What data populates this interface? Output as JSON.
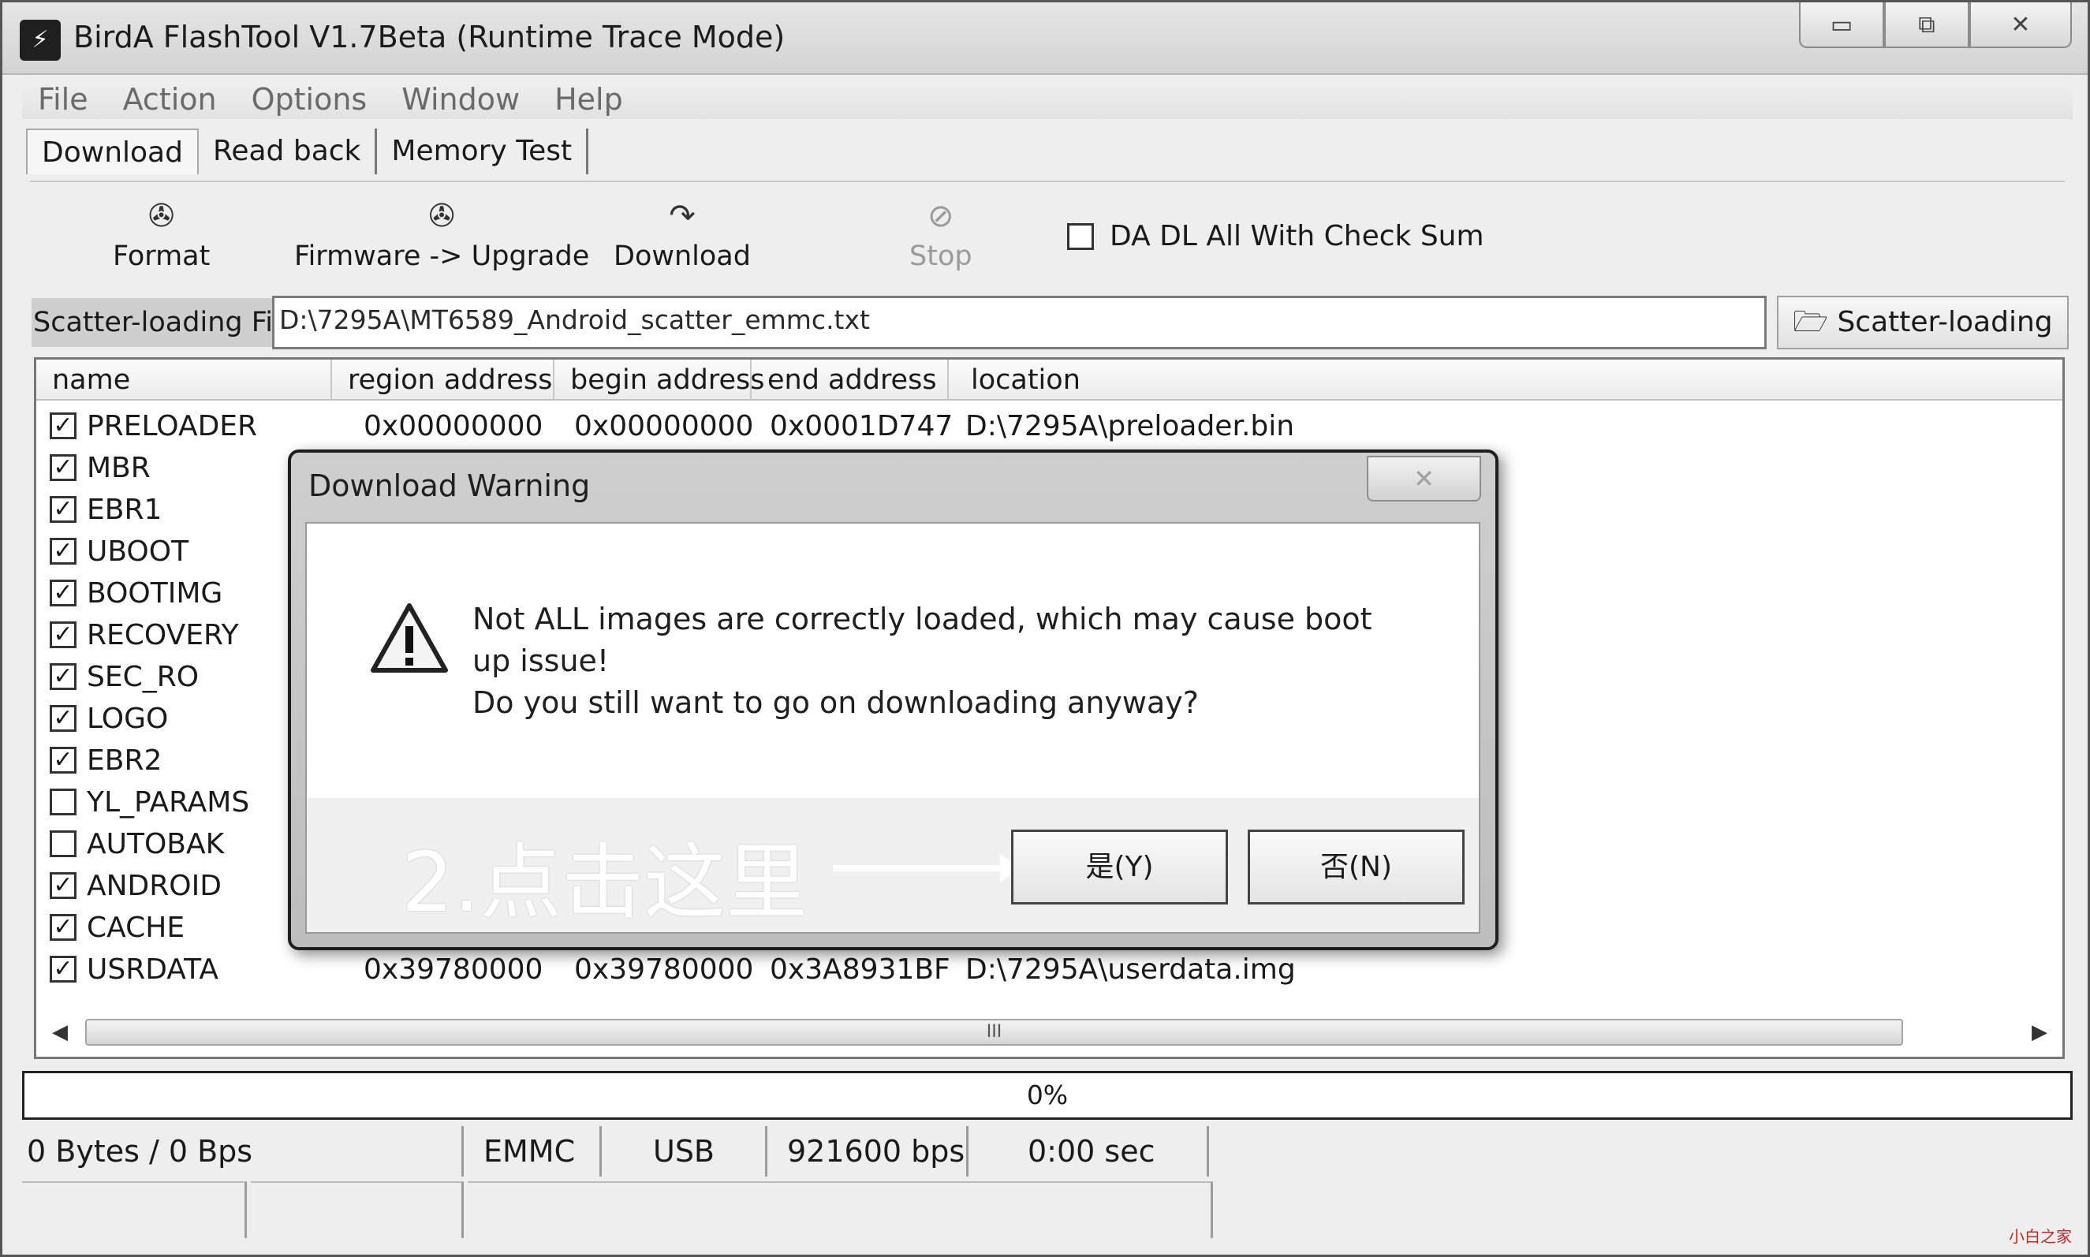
{
  "window": {
    "title": "BirdA FlashTool V1.7Beta (Runtime Trace Mode)",
    "min_glyph": "▭",
    "max_glyph": "⧉",
    "close_glyph": "✕"
  },
  "menu": [
    "File",
    "Action",
    "Options",
    "Window",
    "Help"
  ],
  "tabs": [
    "Download",
    "Read back",
    "Memory Test"
  ],
  "toolbar": {
    "format": "Format",
    "firmware_upgrade": "Firmware -> Upgrade",
    "download": "Download",
    "stop": "Stop",
    "da_dl_checksum": "DA DL All With Check Sum"
  },
  "scatter": {
    "label": "Scatter-loading File",
    "path": "D:\\7295A\\MT6589_Android_scatter_emmc.txt",
    "button": "Scatter-loading"
  },
  "table": {
    "headers": [
      "name",
      "region address",
      "begin address",
      "end address",
      "location"
    ],
    "rows": [
      {
        "checked": true,
        "name": "PRELOADER",
        "region": "0x00000000",
        "begin": "0x00000000",
        "end": "0x0001D747",
        "location": "D:\\7295A\\preloader.bin"
      },
      {
        "checked": true,
        "name": "MBR",
        "region": "",
        "begin": "",
        "end": "",
        "location": ""
      },
      {
        "checked": true,
        "name": "EBR1",
        "region": "",
        "begin": "",
        "end": "",
        "location": ""
      },
      {
        "checked": true,
        "name": "UBOOT",
        "region": "",
        "begin": "",
        "end": "",
        "location": ""
      },
      {
        "checked": true,
        "name": "BOOTIMG",
        "region": "",
        "begin": "",
        "end": "",
        "location": ""
      },
      {
        "checked": true,
        "name": "RECOVERY",
        "region": "",
        "begin": "",
        "end": "",
        "location": ""
      },
      {
        "checked": true,
        "name": "SEC_RO",
        "region": "",
        "begin": "",
        "end": "",
        "location": ""
      },
      {
        "checked": true,
        "name": "LOGO",
        "region": "",
        "begin": "",
        "end": "",
        "location": ""
      },
      {
        "checked": true,
        "name": "EBR2",
        "region": "",
        "begin": "",
        "end": "",
        "location": ""
      },
      {
        "checked": false,
        "name": "YL_PARAMS",
        "region": "",
        "begin": "",
        "end": "",
        "location": ""
      },
      {
        "checked": false,
        "name": "AUTOBAK",
        "region": "",
        "begin": "",
        "end": "",
        "location": ""
      },
      {
        "checked": true,
        "name": "ANDROID",
        "region": "",
        "begin": "",
        "end": "",
        "location": ""
      },
      {
        "checked": true,
        "name": "CACHE",
        "region": "",
        "begin": "",
        "end": "",
        "location": ""
      },
      {
        "checked": true,
        "name": "USRDATA",
        "region": "0x39780000",
        "begin": "0x39780000",
        "end": "0x3A8931BF",
        "location": "D:\\7295A\\userdata.img"
      }
    ],
    "scroll_grip": "III"
  },
  "progress": {
    "text": "0%",
    "value": 0
  },
  "status": {
    "transfer": "0 Bytes / 0 Bps",
    "storage": "EMMC",
    "port": "USB",
    "baud": "921600 bps",
    "time": "0:00 sec"
  },
  "dialog": {
    "title": "Download Warning",
    "close_glyph": "✕",
    "message_line1": "Not ALL images are correctly loaded, which may cause boot up issue!",
    "message_line2": "Do you still want to go on downloading anyway?",
    "yes": "是(Y)",
    "no": "否(N)",
    "annotation": "2.点击这里"
  },
  "watermark": "小白之家",
  "icons": [
    "app-icon",
    "format-icon",
    "firmware-icon",
    "download-icon",
    "stop-icon",
    "folder-open-icon",
    "warning-icon",
    "arrow-icon"
  ]
}
